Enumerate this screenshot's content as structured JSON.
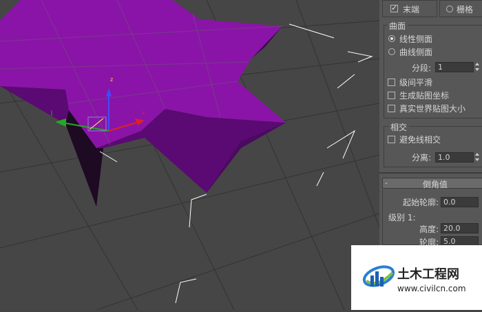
{
  "top_options": {
    "end_label": "末端",
    "end_checked": true,
    "grid_label": "栅格",
    "grid_selected": false
  },
  "surface": {
    "title": "曲面",
    "linear_label": "线性侧面",
    "linear_selected": true,
    "curved_label": "曲线侧面",
    "curved_selected": false,
    "segments_label": "分段:",
    "segments_value": "1",
    "smooth_label": "级间平滑",
    "mapcoords_label": "生成贴图坐标",
    "realworld_label": "真实世界贴图大小"
  },
  "intersect": {
    "title": "相交",
    "avoid_label": "避免线相交",
    "separation_label": "分离:",
    "separation_value": "1.0"
  },
  "bevel": {
    "collapse_symbol": "-",
    "title": "倒角值",
    "start_outline_label": "起始轮廓:",
    "start_outline_value": "0.0",
    "level1_label": "级别 1:",
    "height_label": "高度:",
    "height_value": "20.0",
    "outline_label": "轮廓:",
    "outline_value": "5.0"
  },
  "viewport": {
    "gizmo_z": "z",
    "gizmo_x": "x",
    "object_color": "#8a14a8",
    "side_color": "#5d0a76"
  },
  "watermark": {
    "name": "土木工程网",
    "url": "www.civilcn.com"
  }
}
